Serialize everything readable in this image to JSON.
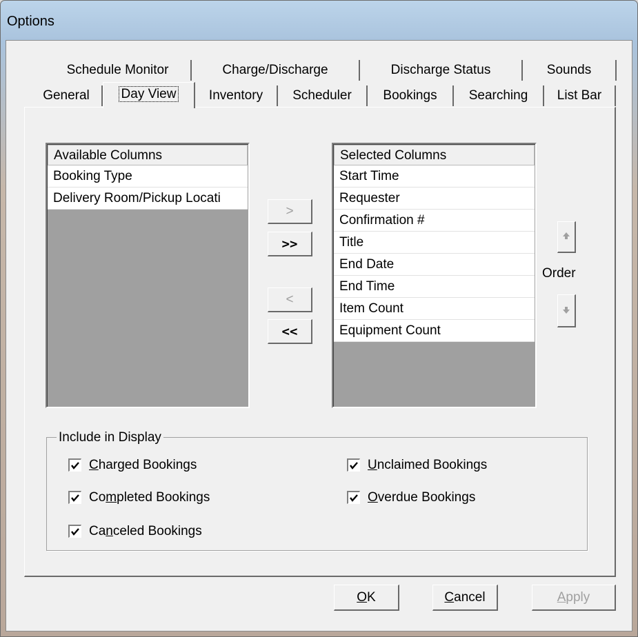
{
  "window": {
    "title": "Options"
  },
  "tabs_back": [
    {
      "label": "Schedule Monitor"
    },
    {
      "label": "Charge/Discharge"
    },
    {
      "label": "Discharge Status"
    },
    {
      "label": "Sounds"
    }
  ],
  "tabs_front": [
    {
      "label": "General"
    },
    {
      "label": "Day View",
      "active": true
    },
    {
      "label": "Inventory"
    },
    {
      "label": "Scheduler"
    },
    {
      "label": "Bookings"
    },
    {
      "label": "Searching"
    },
    {
      "label": "List Bar"
    }
  ],
  "available": {
    "header": "Available Columns",
    "items": [
      "Booking Type",
      "Delivery Room/Pickup Locati"
    ]
  },
  "selected": {
    "header": "Selected Columns",
    "items": [
      "Start Time",
      "Requester",
      "Confirmation #",
      "Title",
      "End Date",
      "End Time",
      "Item Count",
      "Equipment Count"
    ]
  },
  "move": {
    "add_one": ">",
    "add_all": ">>",
    "remove_one": "<",
    "remove_all": "<<"
  },
  "order": {
    "label": "Order",
    "up_icon": "arrow-up-icon",
    "down_icon": "arrow-down-icon"
  },
  "display": {
    "label": "Include in Display",
    "options": [
      {
        "pre": "",
        "mn": "C",
        "post": "harged Bookings",
        "checked": true
      },
      {
        "pre": "Co",
        "mn": "m",
        "post": "pleted Bookings",
        "checked": true
      },
      {
        "pre": "Ca",
        "mn": "n",
        "post": "celed Bookings",
        "checked": true
      },
      {
        "pre": "",
        "mn": "U",
        "post": "nclaimed Bookings",
        "checked": true
      },
      {
        "pre": "",
        "mn": "O",
        "post": "verdue Bookings",
        "checked": true
      }
    ]
  },
  "footer": {
    "ok": {
      "mn": "O",
      "rest": "K"
    },
    "cancel": {
      "mn": "C",
      "rest": "ancel"
    },
    "apply": {
      "mn": "A",
      "rest": "pply",
      "disabled": true
    }
  },
  "colors": {
    "face": "#f0f0f0",
    "list_bg": "#a0a0a0",
    "disabled_text": "#a0a0a0"
  }
}
